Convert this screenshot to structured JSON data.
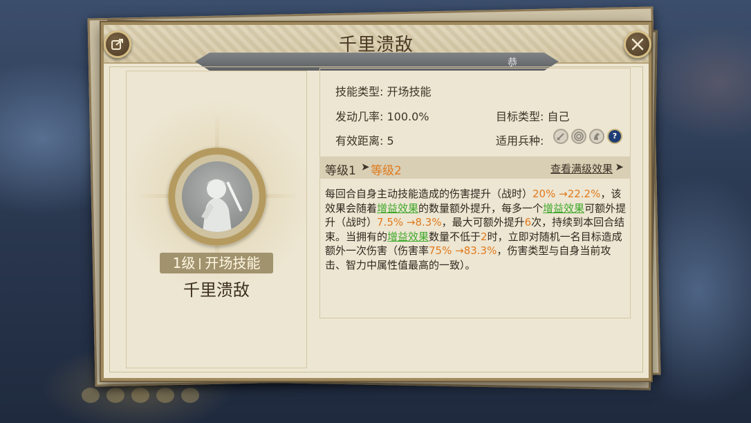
{
  "colors": {
    "accent_orange": "#e07a1d",
    "accent_green": "#3fa82c",
    "panel_bg": "#ede6d2",
    "frame": "#a08a5e"
  },
  "header": {
    "title": "千里溃敌",
    "sub_text": "恭",
    "share_icon": "share-icon",
    "close_icon": "close-icon"
  },
  "left": {
    "level_num": "1级",
    "skill_type": "开场技能",
    "skill_name": "千里溃敌"
  },
  "info": {
    "skill_type_label": "技能类型:",
    "skill_type_value": "开场技能",
    "trigger_rate_label": "发动几率:",
    "trigger_rate_value": "100.0%",
    "target_type_label": "目标类型:",
    "target_type_value": "自己",
    "range_label": "有效距离:",
    "range_value": "5",
    "troops_label": "适用兵种:",
    "troop_icons": [
      "sword-icon",
      "target-icon",
      "horse-icon",
      "question-icon"
    ],
    "troop_q": "?"
  },
  "level_bar": {
    "from": "等级1",
    "arrow": "➤",
    "to": "等级2",
    "view_full": "查看满级效果",
    "view_arrow": "➤"
  },
  "description": {
    "p1": "每回合自身主动技能造成的伤害提升（战时）",
    "v1": "20% →22.2%",
    "p2": "，该效果会随着",
    "k1": "增益效果",
    "p3": "的数量额外提升，每多一个",
    "k2": "增益效果",
    "p4": "可额外提升（战时）",
    "v2": "7.5% →8.3%",
    "p5": "，最大可额外提升",
    "v3": "6",
    "p6": "次，持续到本回合结束。当拥有的",
    "k3": "增益效果",
    "p7": "数量不低于",
    "v4": "2",
    "p8": "时，立即对随机一名目标造成额外一次伤害（伤害率",
    "v5": "75% →83.3%",
    "p9": "，伤害类型与自身当前攻击、智力中属性值最高的一致）。"
  }
}
